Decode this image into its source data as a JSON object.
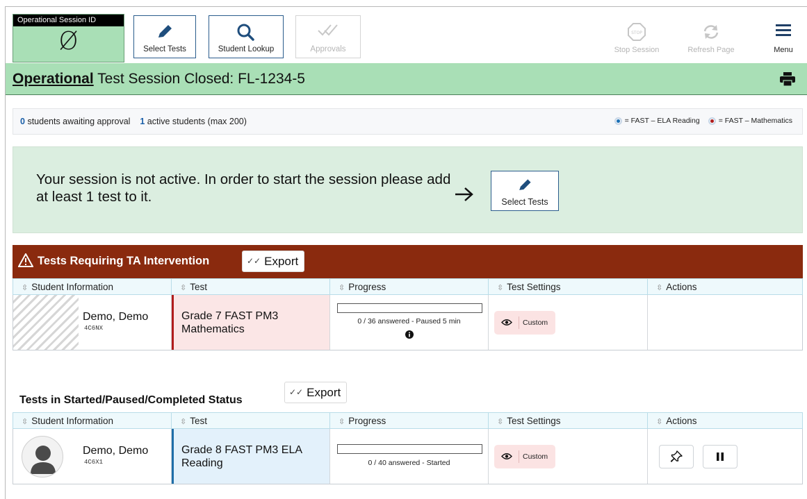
{
  "toolbar": {
    "session_label": "Operational Session ID",
    "session_value": "Ø",
    "buttons": {
      "select_tests": "Select Tests",
      "student_lookup": "Student Lookup",
      "approvals": "Approvals",
      "stop_session": "Stop Session",
      "refresh_page": "Refresh Page",
      "menu": "Menu"
    },
    "icons": {
      "select_tests": "pencil-icon",
      "student_lookup": "search-icon",
      "approvals": "double-check-icon",
      "stop_session": "stop-sign-icon",
      "refresh_page": "refresh-icon",
      "menu": "hamburger-icon"
    }
  },
  "title_bar": {
    "mode": "Operational",
    "text": "Test Session Closed: FL-1234-5",
    "print_icon": "printer-icon"
  },
  "stats": {
    "awaiting_count": "0",
    "awaiting_text": "students awaiting approval",
    "active_count": "1",
    "active_text": "active students (max 200)",
    "legend": [
      {
        "label": "= FAST – ELA Reading",
        "color": "#1a6fb5"
      },
      {
        "label": "= FAST – Mathematics",
        "color": "#b01c1c"
      }
    ]
  },
  "notice": {
    "message": "Your session is not active. In order to start the session please add at least 1 test to it.",
    "button_label": "Select Tests"
  },
  "intervention": {
    "title": "Tests Requiring TA Intervention",
    "export_label": "Export",
    "columns": [
      "Student Information",
      "Test",
      "Progress",
      "Test Settings",
      "Actions"
    ],
    "rows": [
      {
        "student_name": "Demo, Demo",
        "student_id": "4C6NX",
        "test": "Grade 7 FAST PM3 Mathematics",
        "progress_text": "0 / 36 answered  -  Paused  5 min",
        "progress_fraction": 0,
        "settings": "Custom"
      }
    ]
  },
  "started": {
    "title": "Tests in Started/Paused/Completed Status",
    "export_label": "Export",
    "columns": [
      "Student Information",
      "Test",
      "Progress",
      "Test Settings",
      "Actions"
    ],
    "rows": [
      {
        "student_name": "Demo, Demo",
        "student_id": "4C6X1",
        "test": "Grade 8 FAST PM3 ELA Reading",
        "progress_text": "0 / 40 answered  -  Started",
        "progress_fraction": 0,
        "settings": "Custom",
        "actions": [
          "pin-icon",
          "pause-icon"
        ]
      }
    ]
  },
  "colors": {
    "session_green": "#a9dfb6",
    "intervention_header": "#8a2a0e",
    "accent_blue": "#1a5fa8"
  }
}
